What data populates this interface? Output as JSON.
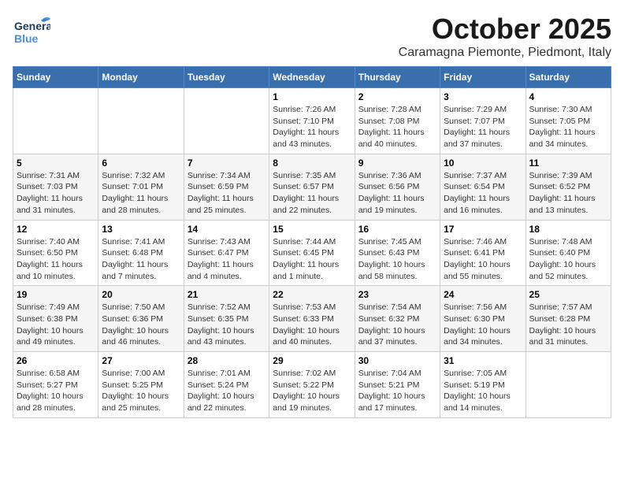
{
  "header": {
    "logo_general": "General",
    "logo_blue": "Blue",
    "month": "October 2025",
    "location": "Caramagna Piemonte, Piedmont, Italy"
  },
  "days_of_week": [
    "Sunday",
    "Monday",
    "Tuesday",
    "Wednesday",
    "Thursday",
    "Friday",
    "Saturday"
  ],
  "weeks": [
    [
      {
        "day": "",
        "info": ""
      },
      {
        "day": "",
        "info": ""
      },
      {
        "day": "",
        "info": ""
      },
      {
        "day": "1",
        "info": "Sunrise: 7:26 AM\nSunset: 7:10 PM\nDaylight: 11 hours and 43 minutes."
      },
      {
        "day": "2",
        "info": "Sunrise: 7:28 AM\nSunset: 7:08 PM\nDaylight: 11 hours and 40 minutes."
      },
      {
        "day": "3",
        "info": "Sunrise: 7:29 AM\nSunset: 7:07 PM\nDaylight: 11 hours and 37 minutes."
      },
      {
        "day": "4",
        "info": "Sunrise: 7:30 AM\nSunset: 7:05 PM\nDaylight: 11 hours and 34 minutes."
      }
    ],
    [
      {
        "day": "5",
        "info": "Sunrise: 7:31 AM\nSunset: 7:03 PM\nDaylight: 11 hours and 31 minutes."
      },
      {
        "day": "6",
        "info": "Sunrise: 7:32 AM\nSunset: 7:01 PM\nDaylight: 11 hours and 28 minutes."
      },
      {
        "day": "7",
        "info": "Sunrise: 7:34 AM\nSunset: 6:59 PM\nDaylight: 11 hours and 25 minutes."
      },
      {
        "day": "8",
        "info": "Sunrise: 7:35 AM\nSunset: 6:57 PM\nDaylight: 11 hours and 22 minutes."
      },
      {
        "day": "9",
        "info": "Sunrise: 7:36 AM\nSunset: 6:56 PM\nDaylight: 11 hours and 19 minutes."
      },
      {
        "day": "10",
        "info": "Sunrise: 7:37 AM\nSunset: 6:54 PM\nDaylight: 11 hours and 16 minutes."
      },
      {
        "day": "11",
        "info": "Sunrise: 7:39 AM\nSunset: 6:52 PM\nDaylight: 11 hours and 13 minutes."
      }
    ],
    [
      {
        "day": "12",
        "info": "Sunrise: 7:40 AM\nSunset: 6:50 PM\nDaylight: 11 hours and 10 minutes."
      },
      {
        "day": "13",
        "info": "Sunrise: 7:41 AM\nSunset: 6:48 PM\nDaylight: 11 hours and 7 minutes."
      },
      {
        "day": "14",
        "info": "Sunrise: 7:43 AM\nSunset: 6:47 PM\nDaylight: 11 hours and 4 minutes."
      },
      {
        "day": "15",
        "info": "Sunrise: 7:44 AM\nSunset: 6:45 PM\nDaylight: 11 hours and 1 minute."
      },
      {
        "day": "16",
        "info": "Sunrise: 7:45 AM\nSunset: 6:43 PM\nDaylight: 10 hours and 58 minutes."
      },
      {
        "day": "17",
        "info": "Sunrise: 7:46 AM\nSunset: 6:41 PM\nDaylight: 10 hours and 55 minutes."
      },
      {
        "day": "18",
        "info": "Sunrise: 7:48 AM\nSunset: 6:40 PM\nDaylight: 10 hours and 52 minutes."
      }
    ],
    [
      {
        "day": "19",
        "info": "Sunrise: 7:49 AM\nSunset: 6:38 PM\nDaylight: 10 hours and 49 minutes."
      },
      {
        "day": "20",
        "info": "Sunrise: 7:50 AM\nSunset: 6:36 PM\nDaylight: 10 hours and 46 minutes."
      },
      {
        "day": "21",
        "info": "Sunrise: 7:52 AM\nSunset: 6:35 PM\nDaylight: 10 hours and 43 minutes."
      },
      {
        "day": "22",
        "info": "Sunrise: 7:53 AM\nSunset: 6:33 PM\nDaylight: 10 hours and 40 minutes."
      },
      {
        "day": "23",
        "info": "Sunrise: 7:54 AM\nSunset: 6:32 PM\nDaylight: 10 hours and 37 minutes."
      },
      {
        "day": "24",
        "info": "Sunrise: 7:56 AM\nSunset: 6:30 PM\nDaylight: 10 hours and 34 minutes."
      },
      {
        "day": "25",
        "info": "Sunrise: 7:57 AM\nSunset: 6:28 PM\nDaylight: 10 hours and 31 minutes."
      }
    ],
    [
      {
        "day": "26",
        "info": "Sunrise: 6:58 AM\nSunset: 5:27 PM\nDaylight: 10 hours and 28 minutes."
      },
      {
        "day": "27",
        "info": "Sunrise: 7:00 AM\nSunset: 5:25 PM\nDaylight: 10 hours and 25 minutes."
      },
      {
        "day": "28",
        "info": "Sunrise: 7:01 AM\nSunset: 5:24 PM\nDaylight: 10 hours and 22 minutes."
      },
      {
        "day": "29",
        "info": "Sunrise: 7:02 AM\nSunset: 5:22 PM\nDaylight: 10 hours and 19 minutes."
      },
      {
        "day": "30",
        "info": "Sunrise: 7:04 AM\nSunset: 5:21 PM\nDaylight: 10 hours and 17 minutes."
      },
      {
        "day": "31",
        "info": "Sunrise: 7:05 AM\nSunset: 5:19 PM\nDaylight: 10 hours and 14 minutes."
      },
      {
        "day": "",
        "info": ""
      }
    ]
  ]
}
